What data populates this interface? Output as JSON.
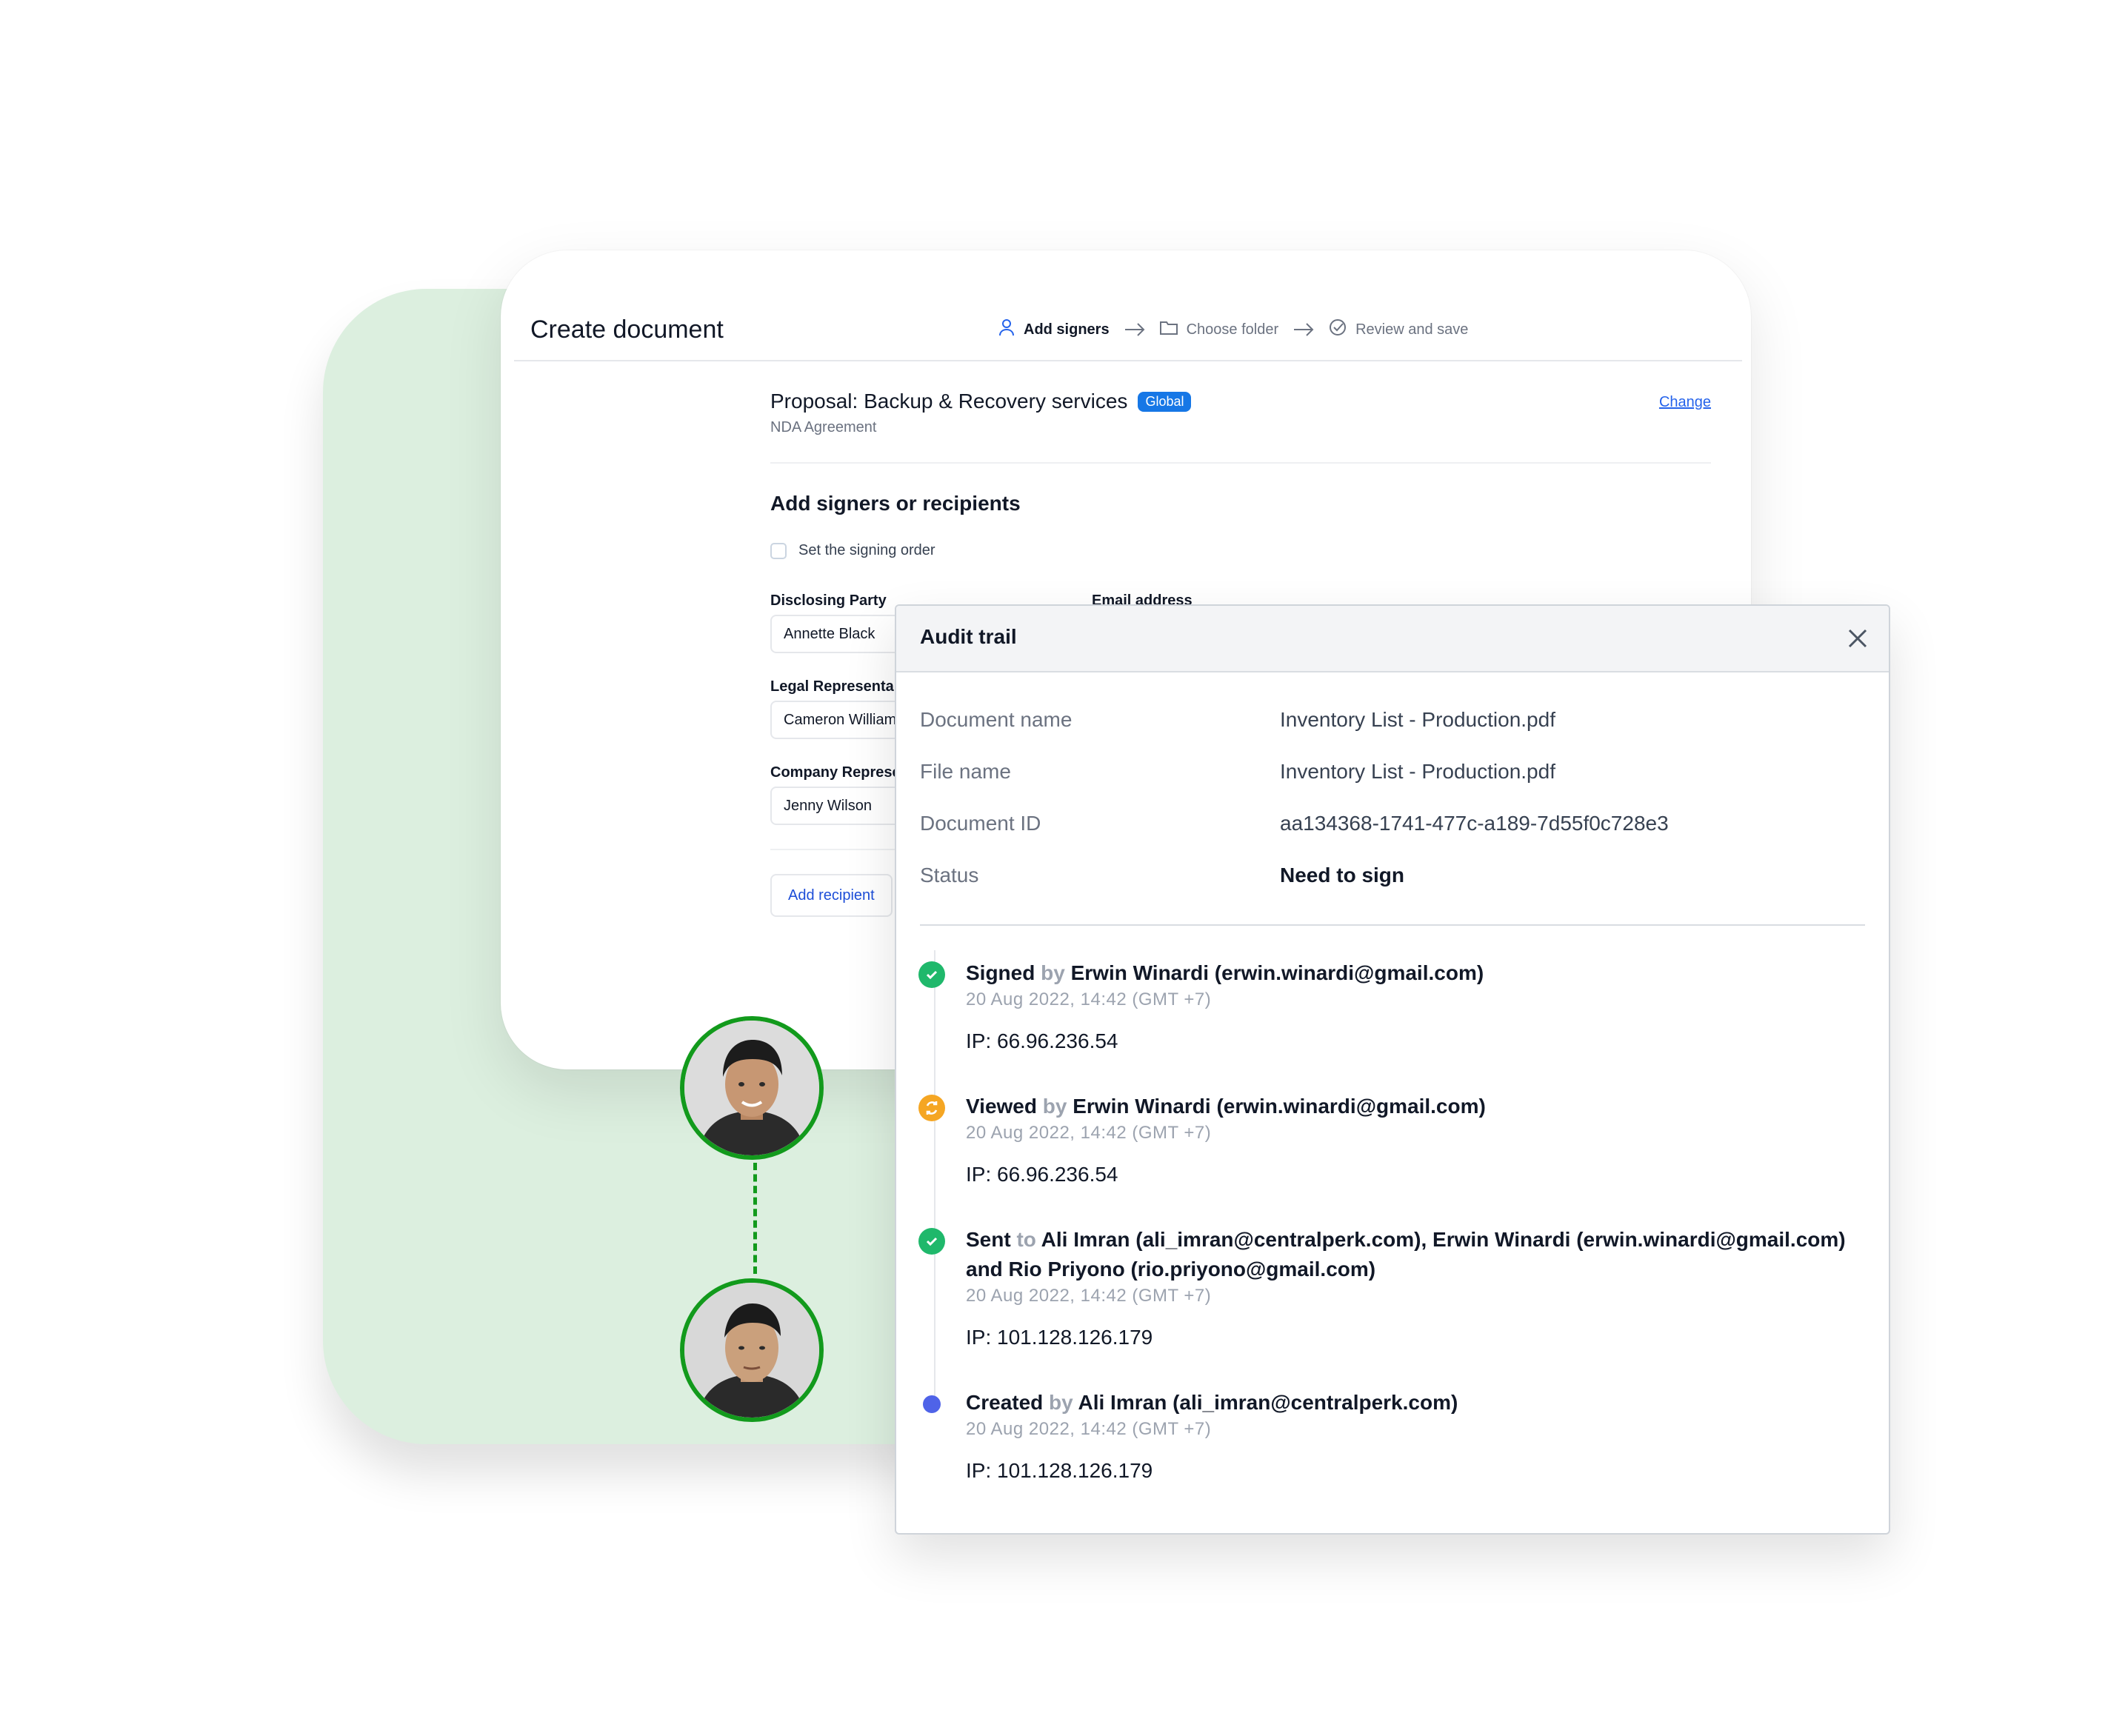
{
  "create_document": {
    "title": "Create document",
    "steps": [
      {
        "label": "Add signers",
        "icon": "user-icon",
        "active": true
      },
      {
        "label": "Choose folder",
        "icon": "folder-icon",
        "active": false
      },
      {
        "label": "Review and save",
        "icon": "check-circle-icon",
        "active": false
      }
    ],
    "proposal": {
      "title": "Proposal: Backup & Recovery services",
      "badge": "Global",
      "subtitle": "NDA Agreement",
      "change_label": "Change"
    },
    "signers_heading": "Add signers or recipients",
    "signing_order_label": "Set the signing order",
    "email_label": "Email address",
    "fields": [
      {
        "label": "Disclosing Party",
        "value": "Annette Black"
      },
      {
        "label": "Legal Representa",
        "value": "Cameron William"
      },
      {
        "label": "Company Represe",
        "value": "Jenny Wilson"
      }
    ],
    "add_recipient_label": "Add recipient"
  },
  "audit_trail": {
    "title": "Audit trail",
    "meta": [
      {
        "key": "Document name",
        "value": "Inventory List - Production.pdf"
      },
      {
        "key": "File name",
        "value": "Inventory List - Production.pdf"
      },
      {
        "key": "Document ID",
        "value": "aa134368-1741-477c-a189-7d55f0c728e3"
      },
      {
        "key": "Status",
        "value": "Need to sign"
      }
    ],
    "events": [
      {
        "action": "Signed",
        "connector": "by",
        "detail": "Erwin Winardi (erwin.winardi@gmail.com)",
        "time": "20 Aug 2022, 14:42 (GMT +7)",
        "ip": "IP: 66.96.236.54",
        "status_icon": "check-icon",
        "status_color": "#1fb86b"
      },
      {
        "action": "Viewed",
        "connector": "by",
        "detail": "Erwin Winardi (erwin.winardi@gmail.com)",
        "time": "20 Aug 2022, 14:42 (GMT +7)",
        "ip": "IP: 66.96.236.54",
        "status_icon": "refresh-icon",
        "status_color": "#f5a623"
      },
      {
        "action": "Sent",
        "connector": "to",
        "detail": "Ali Imran (ali_imran@centralperk.com), Erwin Winardi (erwin.winardi@gmail.com) and Rio Priyono (rio.priyono@gmail.com)",
        "time": "20 Aug 2022, 14:42 (GMT +7)",
        "ip": "IP: 101.128.126.179",
        "status_icon": "check-icon",
        "status_color": "#1fb86b"
      },
      {
        "action": "Created",
        "connector": "by",
        "detail": "Ali Imran (ali_imran@centralperk.com)",
        "time": "20 Aug 2022, 14:42 (GMT +7)",
        "ip": "IP: 101.128.126.179",
        "status_icon": "dot-icon",
        "status_color": "#4f63e8"
      }
    ]
  },
  "colors": {
    "accent": "#1677e6",
    "link": "#2563eb",
    "avatar_ring": "#129a1c",
    "green_panel": "#dcefdf"
  }
}
